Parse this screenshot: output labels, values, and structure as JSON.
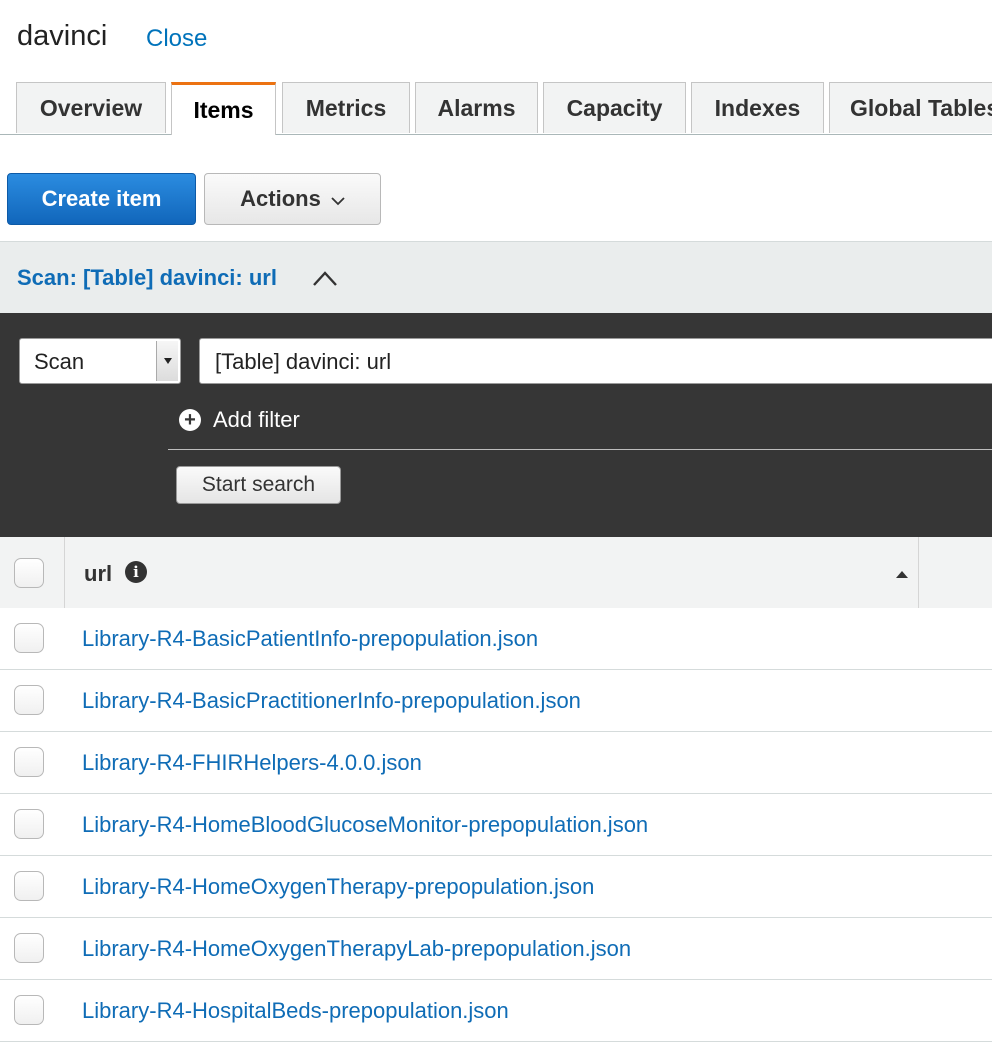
{
  "header": {
    "title": "davinci",
    "close_label": "Close"
  },
  "tabs": [
    {
      "label": "Overview",
      "active": false
    },
    {
      "label": "Items",
      "active": true
    },
    {
      "label": "Metrics",
      "active": false
    },
    {
      "label": "Alarms",
      "active": false
    },
    {
      "label": "Capacity",
      "active": false
    },
    {
      "label": "Indexes",
      "active": false
    },
    {
      "label": "Global Tables",
      "active": false
    }
  ],
  "toolbar": {
    "create_label": "Create item",
    "actions_label": "Actions"
  },
  "scan": {
    "summary": "Scan: [Table] davinci: url",
    "mode": "Scan",
    "target": "[Table] davinci: url",
    "add_filter_label": "Add filter",
    "start_label": "Start search"
  },
  "table": {
    "column": "url",
    "rows": [
      "Library-R4-BasicPatientInfo-prepopulation.json",
      "Library-R4-BasicPractitionerInfo-prepopulation.json",
      "Library-R4-FHIRHelpers-4.0.0.json",
      "Library-R4-HomeBloodGlucoseMonitor-prepopulation.json",
      "Library-R4-HomeOxygenTherapy-prepopulation.json",
      "Library-R4-HomeOxygenTherapyLab-prepopulation.json",
      "Library-R4-HospitalBeds-prepopulation.json"
    ]
  },
  "colors": {
    "link": "#0f6cb6",
    "primary": "#1a73c9",
    "active_tab": "#ec7211",
    "panel": "#363636"
  }
}
